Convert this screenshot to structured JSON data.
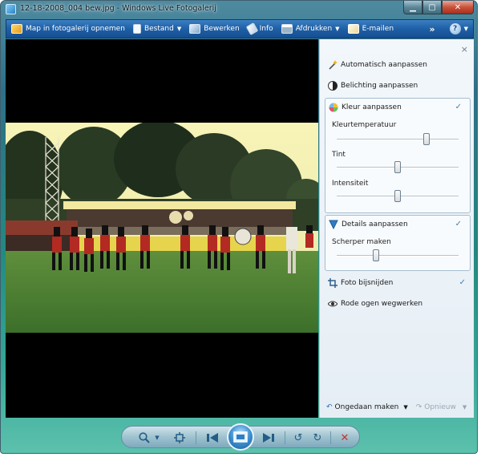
{
  "window": {
    "title": "12-18-2008_004 bew.jpg - Windows Live Fotogalerij",
    "controls": {
      "minimize": "▁",
      "maximize": "▢",
      "close": "✕"
    }
  },
  "toolbar": {
    "items": [
      {
        "label": "Map in fotogalerij opnemen",
        "icon": "add-folder-icon"
      },
      {
        "label": "Bestand",
        "icon": "file-icon",
        "dropdown": true
      },
      {
        "label": "Bewerken",
        "icon": "edit-icon"
      },
      {
        "label": "Info",
        "icon": "info-tag-icon"
      },
      {
        "label": "Afdrukken",
        "icon": "printer-icon",
        "dropdown": true
      },
      {
        "label": "E-mailen",
        "icon": "email-icon"
      }
    ],
    "more": "»",
    "help": "?"
  },
  "panel": {
    "close": "×",
    "auto_adjust": "Automatisch aanpassen",
    "exposure": "Belichting aanpassen",
    "color": {
      "title": "Kleur aanpassen",
      "checked": true,
      "sliders": [
        {
          "label": "Kleurtemperatuur",
          "value": 0.74
        },
        {
          "label": "Tint",
          "value": 0.5
        },
        {
          "label": "Intensiteit",
          "value": 0.5
        }
      ]
    },
    "details": {
      "title": "Details aanpassen",
      "checked": true,
      "sliders": [
        {
          "label": "Scherper maken",
          "value": 0.32
        }
      ]
    },
    "crop": {
      "label": "Foto bijsnijden",
      "checked": true
    },
    "redeye": "Rode ogen wegwerken",
    "undo": "Ongedaan maken",
    "redo": "Opnieuw",
    "checkmark": "✓"
  },
  "colors": {
    "toolbar": "#1e5fa6",
    "panel_bg": "#eef4f9",
    "accent_check": "#4a7fa8",
    "delete_red": "#d0302a"
  },
  "bottom_controls": [
    "zoom-icon",
    "actual-size-icon",
    "previous-icon",
    "slideshow-icon",
    "next-icon",
    "rotate-left-icon",
    "rotate-right-icon",
    "delete-icon"
  ]
}
